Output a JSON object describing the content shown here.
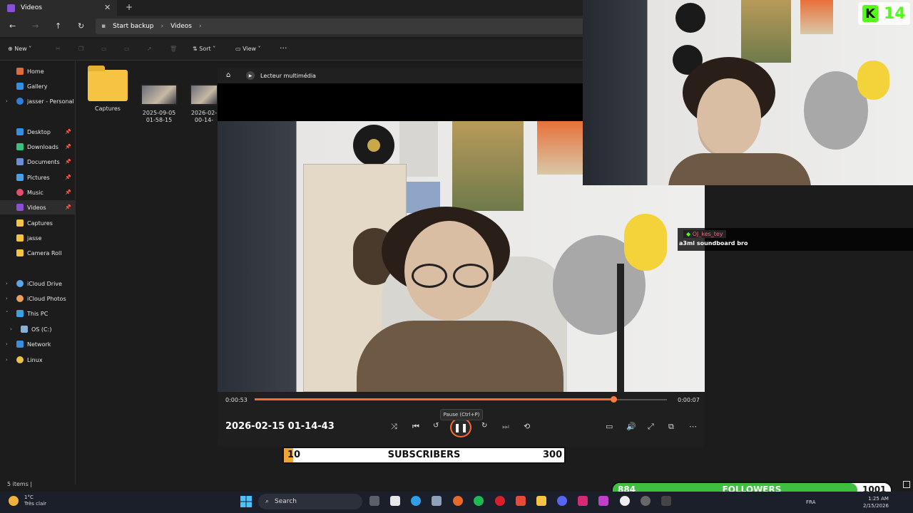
{
  "explorer": {
    "tab_title": "Videos",
    "breadcrumb": [
      "Start backup",
      "Videos"
    ],
    "toolbar": {
      "new": "New",
      "sort": "Sort",
      "view": "View"
    },
    "sidebar": [
      {
        "label": "Home"
      },
      {
        "label": "Gallery"
      },
      {
        "label": "jasser - Personal"
      },
      {
        "label": "Desktop"
      },
      {
        "label": "Downloads"
      },
      {
        "label": "Documents"
      },
      {
        "label": "Pictures"
      },
      {
        "label": "Music"
      },
      {
        "label": "Videos"
      },
      {
        "label": "Captures"
      },
      {
        "label": "jasse"
      },
      {
        "label": "Camera Roll"
      },
      {
        "label": "iCloud Drive"
      },
      {
        "label": "iCloud Photos"
      },
      {
        "label": "This PC"
      },
      {
        "label": "OS (C:)"
      },
      {
        "label": "Network"
      },
      {
        "label": "Linux"
      }
    ],
    "files": [
      {
        "name": "Captures"
      },
      {
        "name": "2025-09-05",
        "name2": "01-58-15"
      },
      {
        "name": "2026-02-",
        "name2": "00-14-"
      }
    ],
    "status": "5 items"
  },
  "player": {
    "app_name": "Lecteur multimédia",
    "elapsed": "0:00:53",
    "remaining": "0:00:07",
    "progress": 0.87,
    "file_title": "2026-02-15 01-14-43",
    "tooltip": "Pause (Ctrl+P)"
  },
  "overlay": {
    "kick_count": "14",
    "chat_user": "OJ_kes_tey",
    "chat_message": "a3ml soundboard bro",
    "subscribers": {
      "current": "10",
      "label": "SUBSCRIBERS",
      "goal": "300",
      "fraction": 0.033
    },
    "followers": {
      "current": "884",
      "label": "FOLLOWERS",
      "goal": "1001",
      "fraction": 0.88
    }
  },
  "taskbar": {
    "temp": "1°C",
    "condition": "Très clair",
    "search_placeholder": "Search",
    "lang": "FRA",
    "time": "1:25 AM",
    "date": "2/15/2026"
  },
  "colors": {
    "accent": "#ff6a2c",
    "kick_green": "#53fc18",
    "followers_green": "#3fbf3f",
    "subs_orange": "#f0a33a"
  }
}
